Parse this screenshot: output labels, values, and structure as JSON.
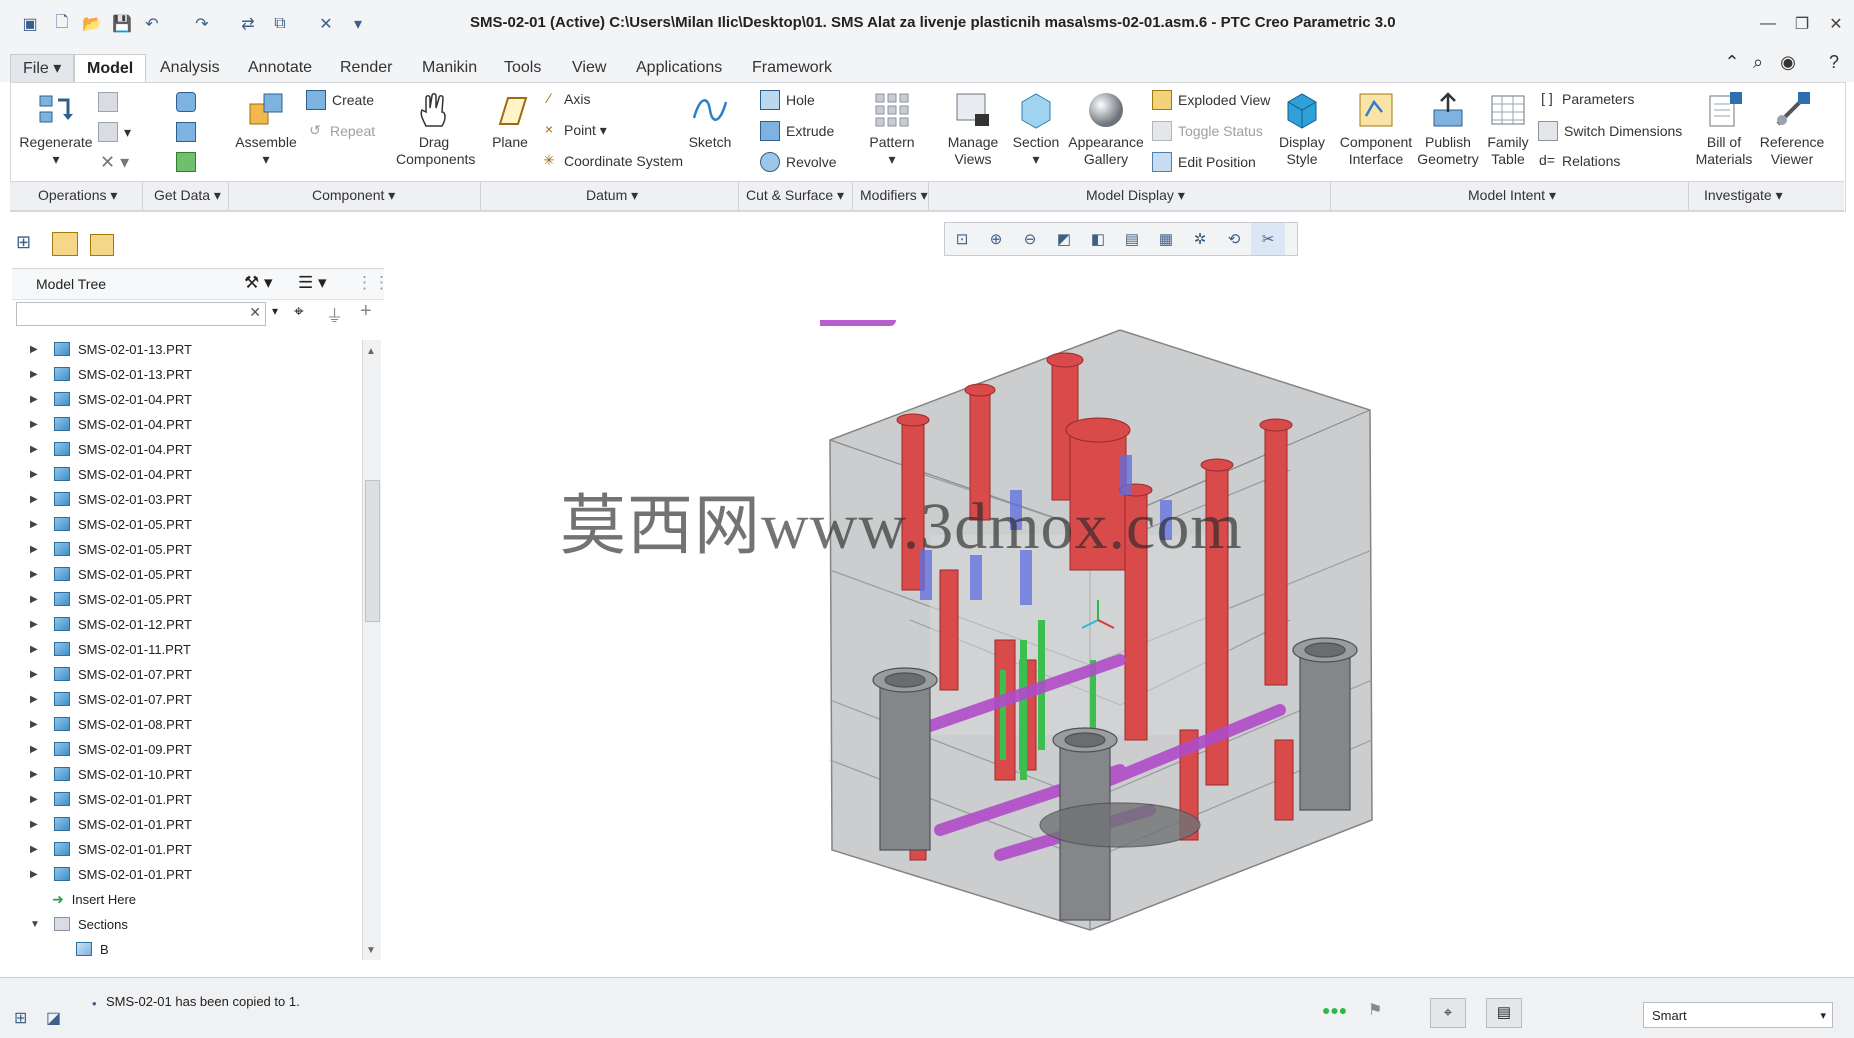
{
  "window": {
    "title": "SMS-02-01 (Active) C:\\Users\\Milan Ilic\\Desktop\\01. SMS Alat za livenje plasticnih masa\\sms-02-01.asm.6 - PTC Creo Parametric 3.0"
  },
  "tabs": [
    "File",
    "Model",
    "Analysis",
    "Annotate",
    "Render",
    "Manikin",
    "Tools",
    "View",
    "Applications",
    "Framework"
  ],
  "ribbon": {
    "operations": {
      "regenerate": "Regenerate"
    },
    "get_data": {},
    "component": {
      "assemble": "Assemble",
      "create": "Create",
      "repeat": "Repeat",
      "drag": "Drag Components"
    },
    "datum": {
      "plane": "Plane",
      "axis": "Axis",
      "point": "Point",
      "csys": "Coordinate System",
      "sketch": "Sketch"
    },
    "cut_surface": {
      "hole": "Hole",
      "extrude": "Extrude",
      "revolve": "Revolve"
    },
    "modifiers": {
      "pattern": "Pattern"
    },
    "model_display": {
      "manage_views": "Manage Views",
      "section": "Section",
      "appearance": "Appearance Gallery",
      "exploded": "Exploded View",
      "toggle": "Toggle Status",
      "edit_pos": "Edit Position",
      "display_style": "Display Style"
    },
    "model_intent": {
      "comp_interface": "Component Interface",
      "publish": "Publish Geometry",
      "family": "Family Table",
      "parameters": "Parameters",
      "switch_dims": "Switch Dimensions",
      "relations": "Relations"
    },
    "investigate": {
      "bom": "Bill of Materials",
      "ref_viewer": "Reference Viewer"
    },
    "groups": [
      "Operations",
      "Get Data",
      "Component",
      "Datum",
      "Cut & Surface",
      "Modifiers",
      "Model Display",
      "Model Intent",
      "Investigate"
    ]
  },
  "model_tree": {
    "header": "Model Tree",
    "items": [
      "SMS-02-01-13.PRT",
      "SMS-02-01-13.PRT",
      "SMS-02-01-04.PRT",
      "SMS-02-01-04.PRT",
      "SMS-02-01-04.PRT",
      "SMS-02-01-04.PRT",
      "SMS-02-01-03.PRT",
      "SMS-02-01-05.PRT",
      "SMS-02-01-05.PRT",
      "SMS-02-01-05.PRT",
      "SMS-02-01-05.PRT",
      "SMS-02-01-12.PRT",
      "SMS-02-01-11.PRT",
      "SMS-02-01-07.PRT",
      "SMS-02-01-07.PRT",
      "SMS-02-01-08.PRT",
      "SMS-02-01-09.PRT",
      "SMS-02-01-10.PRT",
      "SMS-02-01-01.PRT",
      "SMS-02-01-01.PRT",
      "SMS-02-01-01.PRT",
      "SMS-02-01-01.PRT"
    ],
    "insert_here": "Insert Here",
    "sections": "Sections",
    "section_child": "B"
  },
  "watermark": "莫西网www.3dmox.com",
  "status": {
    "message": "SMS-02-01 has been copied to 1.",
    "filter": "Smart"
  },
  "colors": {
    "accent": "#3f8fc9",
    "red": "#d43a3a",
    "gray": "#808285",
    "purple": "#b04cc9",
    "green": "#33b84a"
  }
}
